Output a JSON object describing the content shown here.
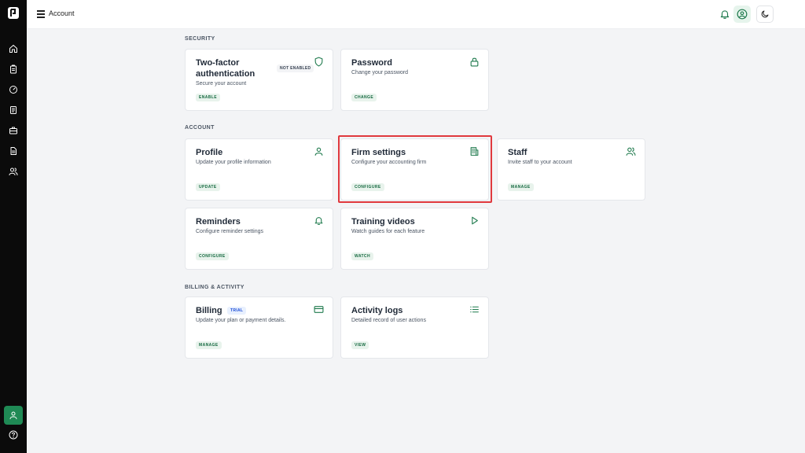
{
  "header": {
    "title": "Account"
  },
  "sections": {
    "security": "SECURITY",
    "account": "ACCOUNT",
    "billing": "BILLING & ACTIVITY"
  },
  "cards": {
    "two_factor": {
      "title": "Two-factor authentication",
      "desc": "Secure your account",
      "action": "ENABLE",
      "badge": "NOT ENABLED",
      "icon": "shield-icon"
    },
    "password": {
      "title": "Password",
      "desc": "Change your password",
      "action": "CHANGE",
      "icon": "lock-icon"
    },
    "profile": {
      "title": "Profile",
      "desc": "Update your profile information",
      "action": "UPDATE",
      "icon": "user-icon"
    },
    "firm_settings": {
      "title": "Firm settings",
      "desc": "Configure your accounting firm",
      "action": "CONFIGURE",
      "icon": "building-icon"
    },
    "staff": {
      "title": "Staff",
      "desc": "Invite staff to your account",
      "action": "MANAGE",
      "icon": "users-icon"
    },
    "reminders": {
      "title": "Reminders",
      "desc": "Configure reminder settings",
      "action": "CONFIGURE",
      "icon": "bell-icon"
    },
    "training": {
      "title": "Training videos",
      "desc": "Watch guides for each feature",
      "action": "WATCH",
      "icon": "play-icon"
    },
    "billing": {
      "title": "Billing",
      "desc": "Update your plan or payment details.",
      "action": "MANAGE",
      "badge": "TRIAL",
      "icon": "credit-card-icon"
    },
    "activity": {
      "title": "Activity logs",
      "desc": "Detailed record of user actions",
      "action": "VIEW",
      "icon": "list-icon"
    }
  },
  "colors": {
    "accent": "#1f7a4d",
    "sidebar": "#0b0b0b",
    "highlight": "#e0393e"
  }
}
